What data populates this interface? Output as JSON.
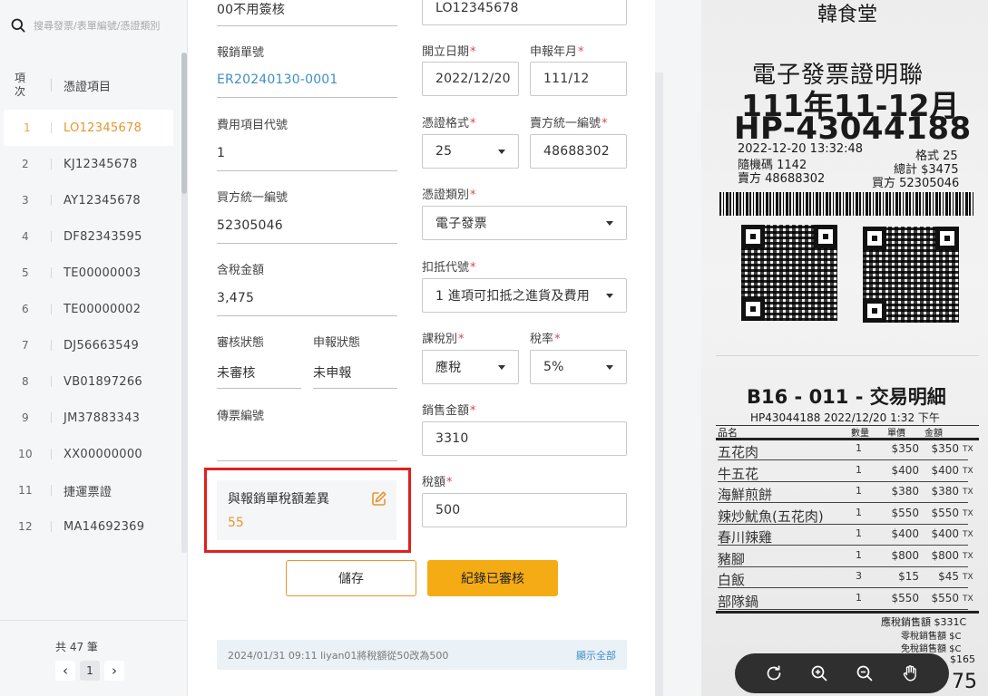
{
  "search": {
    "placeholder": "搜尋發票/表單編號/憑證類別"
  },
  "list": {
    "col_index": "項次",
    "col_item": "憑證項目",
    "rows": [
      {
        "idx": "1",
        "item": "LO12345678"
      },
      {
        "idx": "2",
        "item": "KJ12345678"
      },
      {
        "idx": "3",
        "item": "AY12345678"
      },
      {
        "idx": "4",
        "item": "DF82343595"
      },
      {
        "idx": "5",
        "item": "TE00000003"
      },
      {
        "idx": "6",
        "item": "TE00000002"
      },
      {
        "idx": "7",
        "item": "DJ56663549"
      },
      {
        "idx": "8",
        "item": "VB01897266"
      },
      {
        "idx": "9",
        "item": "JM37883343"
      },
      {
        "idx": "10",
        "item": "XX00000000"
      },
      {
        "idx": "11",
        "item": "捷運票證"
      },
      {
        "idx": "12",
        "item": "MA14692369"
      }
    ],
    "active_index": 0,
    "total": "共 47 筆",
    "page": "1"
  },
  "form": {
    "top_left_value": "00不用簽核",
    "top_right_value": "LO12345678",
    "report_no_label": "報銷單號",
    "report_no_value": "ER20240130-0001",
    "expense_code_label": "費用項目代號",
    "expense_code_value": "1",
    "buyer_id_label": "買方統一編號",
    "buyer_id_value": "52305046",
    "tax_incl_label": "含稅金額",
    "tax_incl_value": "3,475",
    "review_status_label": "審核狀態",
    "review_status_value": "未審核",
    "report_status_label": "申報狀態",
    "report_status_value": "未申報",
    "voucher_no_label": "傳票編號",
    "voucher_no_value": "",
    "issue_date_label": "開立日期",
    "issue_date_value": "2022/12/20",
    "report_ym_label": "申報年月",
    "report_ym_value": "111/12",
    "format_label": "憑證格式",
    "format_value": "25",
    "seller_id_label": "賣方統一編號",
    "seller_id_value": "48688302",
    "type_label": "憑證類別",
    "type_value": "電子發票",
    "deduct_label": "扣抵代號",
    "deduct_value": "1 進項可扣抵之進貨及費用",
    "tax_type_label": "課稅別",
    "tax_type_value": "應稅",
    "tax_rate_label": "稅率",
    "tax_rate_value": "5%",
    "sales_label": "銷售金額",
    "sales_value": "3310",
    "tax_label": "稅額",
    "tax_value": "500",
    "required_mark": "*",
    "diff_label": "與報銷單稅額差異",
    "diff_value": "55",
    "save_label": "儲存",
    "approve_label": "紀錄已審核"
  },
  "log": {
    "text": "2024/01/31 09:11   liyan01將稅額從50改為500",
    "show_all": "顯示全部"
  },
  "receipt": {
    "store": "韓食堂",
    "title": "電子發票證明聯",
    "period": "111年11-12月",
    "number": "HP-43044188",
    "datetime": "2022-12-20 13:32:48",
    "format": "格式 25",
    "random": "隨機碼 1142",
    "total": "總計 $3475",
    "seller": "賣方 48688302",
    "buyer": "買方 52305046",
    "detail_title": "B16 - 011 - 交易明細",
    "detail_sub": "HP43044188 2022/12/20 1:32 下午",
    "col_name": "品名",
    "col_qty": "數量",
    "col_price": "單價",
    "col_amt": "金額",
    "items": [
      {
        "name": "五花肉",
        "qty": "1",
        "price": "$350",
        "amt": "$350",
        "tx": "TX"
      },
      {
        "name": "牛五花",
        "qty": "1",
        "price": "$400",
        "amt": "$400",
        "tx": "TX"
      },
      {
        "name": "海鮮煎餅",
        "qty": "1",
        "price": "$380",
        "amt": "$380",
        "tx": "TX"
      },
      {
        "name": "辣炒魷魚(五花肉)",
        "qty": "1",
        "price": "$550",
        "amt": "$550",
        "tx": "TX"
      },
      {
        "name": "春川辣雞",
        "qty": "1",
        "price": "$400",
        "amt": "$400",
        "tx": "TX"
      },
      {
        "name": "豬腳",
        "qty": "1",
        "price": "$800",
        "amt": "$800",
        "tx": "TX"
      },
      {
        "name": "白飯",
        "qty": "3",
        "price": "$15",
        "amt": "$45",
        "tx": "TX"
      },
      {
        "name": "部隊鍋",
        "qty": "1",
        "price": "$550",
        "amt": "$550",
        "tx": "TX"
      }
    ],
    "sum1": "應稅銷售額 $331C",
    "sum2": "零稅銷售額 $C",
    "sum3": "免稅銷售額 $C",
    "sum4": "$165",
    "sum5": "75"
  },
  "toolbar": {
    "rotate_icon": "rotate-icon",
    "zoom_in_icon": "zoom-in-icon",
    "zoom_out_icon": "zoom-out-icon",
    "pan_icon": "hand-pan-icon"
  },
  "colors": {
    "accent": "#e6962f",
    "primary_button": "#f5ac14",
    "link": "#3e8fc7",
    "required": "#e0474c",
    "highlight_outline": "#e02020"
  }
}
